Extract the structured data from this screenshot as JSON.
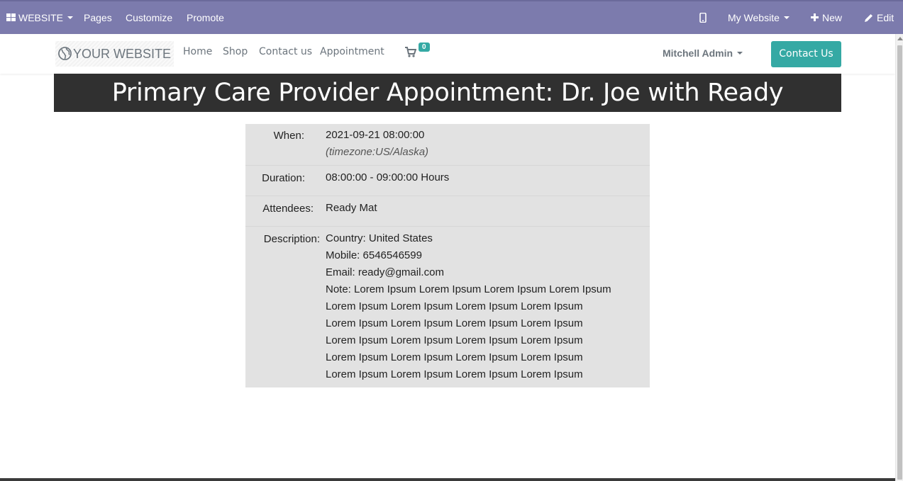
{
  "topbar": {
    "website_label": "WEBSITE",
    "pages_label": "Pages",
    "customize_label": "Customize",
    "promote_label": "Promote",
    "my_website_label": "My Website",
    "new_label": "New",
    "edit_label": "Edit",
    "bar_color": "#7c7bad"
  },
  "header": {
    "logo_text": "YOUR WEBSITE",
    "nav": [
      "Home",
      "Shop",
      "Contact us",
      "Appointment"
    ],
    "cart_count": "0",
    "user_name": "Mitchell Admin",
    "contact_button": "Contact Us",
    "accent_color": "#35a9a4"
  },
  "page": {
    "title": "Primary Care Provider Appointment: Dr. Joe with Ready"
  },
  "details": {
    "when_label": "When:",
    "when_value": "2021-09-21 08:00:00",
    "timezone": "(timezone:US/Alaska)",
    "duration_label": "Duration:",
    "duration_value": "08:00:00 - 09:00:00 Hours",
    "attendees_label": "Attendees:",
    "attendees_value": "Ready Mat",
    "description_label": "Description:",
    "description_lines": [
      "Country: United States",
      "Mobile: 6546546599",
      "Email: ready@gmail.com",
      "Note: Lorem Ipsum Lorem Ipsum Lorem Ipsum Lorem Ipsum",
      "Lorem Ipsum Lorem Ipsum Lorem Ipsum Lorem Ipsum",
      "Lorem Ipsum Lorem Ipsum Lorem Ipsum Lorem Ipsum",
      "Lorem Ipsum Lorem Ipsum Lorem Ipsum Lorem Ipsum",
      "Lorem Ipsum Lorem Ipsum Lorem Ipsum Lorem Ipsum",
      "Lorem Ipsum Lorem Ipsum Lorem Ipsum Lorem Ipsum"
    ]
  }
}
